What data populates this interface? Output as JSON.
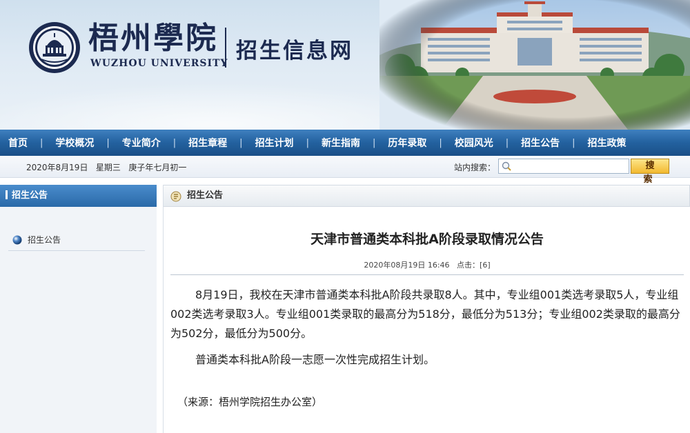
{
  "banner": {
    "school_name_cn": "梧州學院",
    "school_name_en": "WUZHOU UNIVERSITY",
    "site_name": "招生信息网",
    "colors": {
      "brand_navy": "#1c2a50",
      "nav_blue": "#23619f",
      "search_gold": "#f2b92f"
    }
  },
  "nav": {
    "items": [
      "首页",
      "学校概况",
      "专业简介",
      "招生章程",
      "招生计划",
      "新生指南",
      "历年录取",
      "校园风光",
      "招生公告",
      "招生政策"
    ],
    "separator": "|"
  },
  "datebar": {
    "date": "2020年8月19日",
    "weekday": "星期三",
    "lunar": "庚子年七月初一",
    "search_label": "站内搜索：",
    "search_value": "",
    "search_button": "搜 索"
  },
  "sidebar": {
    "heading": "招生公告",
    "items": [
      {
        "label": "招生公告",
        "icon": "blue-orb-icon"
      }
    ]
  },
  "main": {
    "heading": "招生公告",
    "article": {
      "title": "天津市普通类本科批A阶段录取情况公告",
      "date": "2020年08月19日 16:46",
      "clicks_label": "点击：",
      "clicks_value": "[6]",
      "paragraphs": [
        "8月19日，我校在天津市普通类本科批A阶段共录取8人。其中，专业组001类选考录取5人，专业组002类选考录取3人。专业组001类录取的最高分为518分，最低分为513分；专业组002类录取的最高分为502分，最低分为500分。",
        "普通类本科批A阶段一志愿一次性完成招生计划。"
      ],
      "source": "（来源：梧州学院招生办公室）"
    }
  }
}
